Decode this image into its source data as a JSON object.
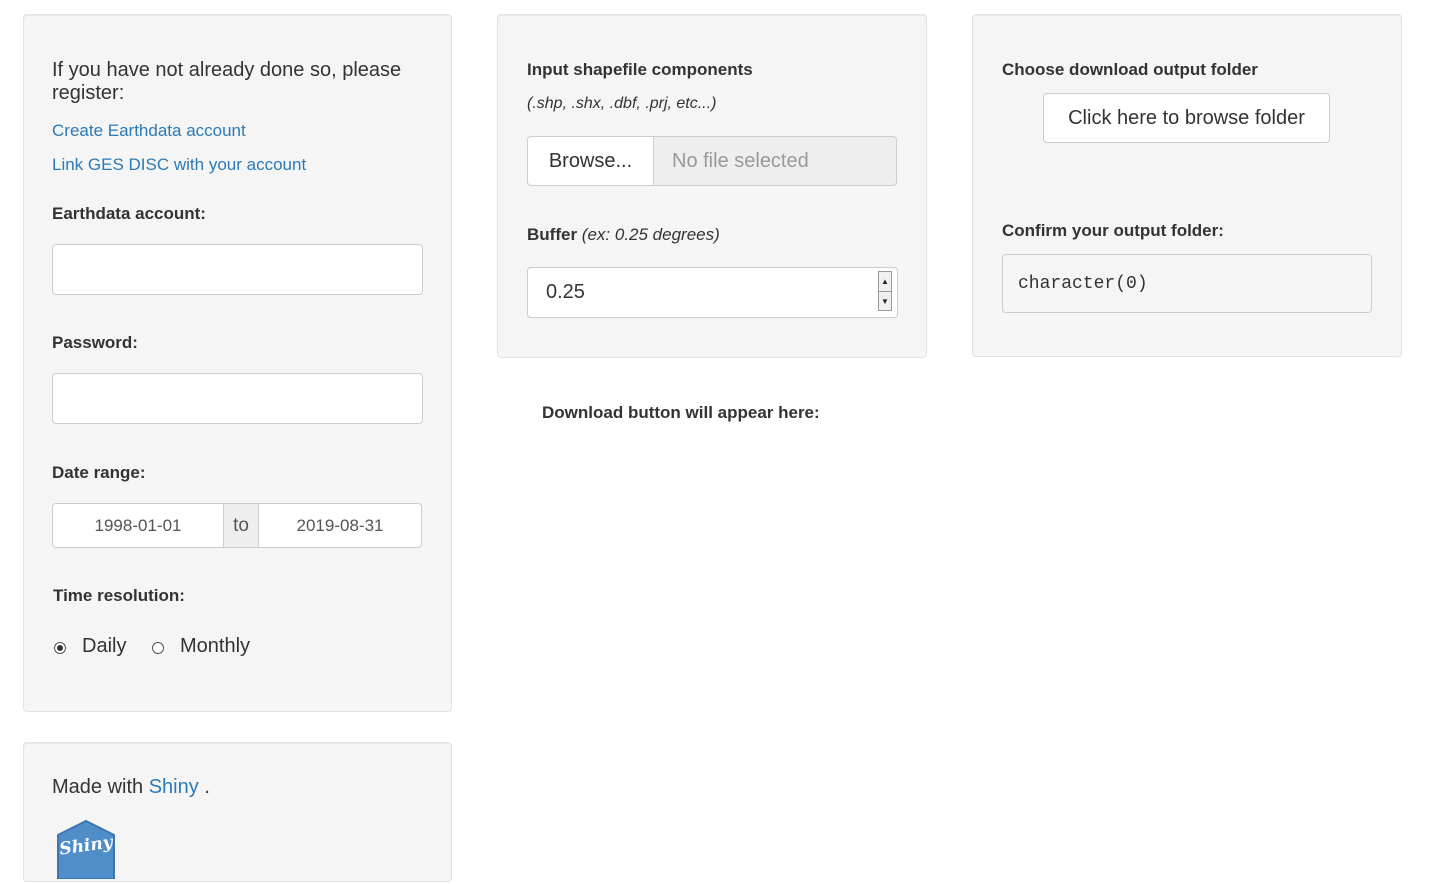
{
  "left_panel": {
    "intro": "If you have not already done so, please register:",
    "links": {
      "create_account": "Create Earthdata account",
      "link_ges_disc": "Link GES DISC with your account"
    },
    "account_label": "Earthdata account:",
    "account_value": "",
    "password_label": "Password:",
    "password_value": "",
    "date_range_label": "Date range:",
    "date_start": "1998-01-01",
    "date_separator": "to",
    "date_end": "2019-08-31",
    "time_resolution_label": "Time resolution:",
    "options": [
      "Daily",
      "Monthly"
    ],
    "selected_option": "Daily"
  },
  "middle_panel": {
    "shapefile_label": "Input shapefile components",
    "shapefile_hint": "(.shp, .shx, .dbf, .prj, etc...)",
    "browse_button": "Browse...",
    "file_placeholder": "No file selected",
    "buffer_label": "Buffer",
    "buffer_hint": "(ex: 0.25 degrees)",
    "buffer_value": "0.25"
  },
  "right_panel": {
    "folder_label": "Choose download output folder",
    "browse_folder_button": "Click here to browse folder",
    "confirm_label": "Confirm your output folder:",
    "confirm_value": "character(0)"
  },
  "download_notice": "Download button will appear here:",
  "footer": {
    "made_with": "Made with",
    "shiny_link": "Shiny",
    "period": ".",
    "logo_text": "Shiny"
  },
  "colors": {
    "link": "#2a7ab8",
    "well_bg": "#f5f5f5",
    "logo_blue": "#4f8ec9"
  }
}
